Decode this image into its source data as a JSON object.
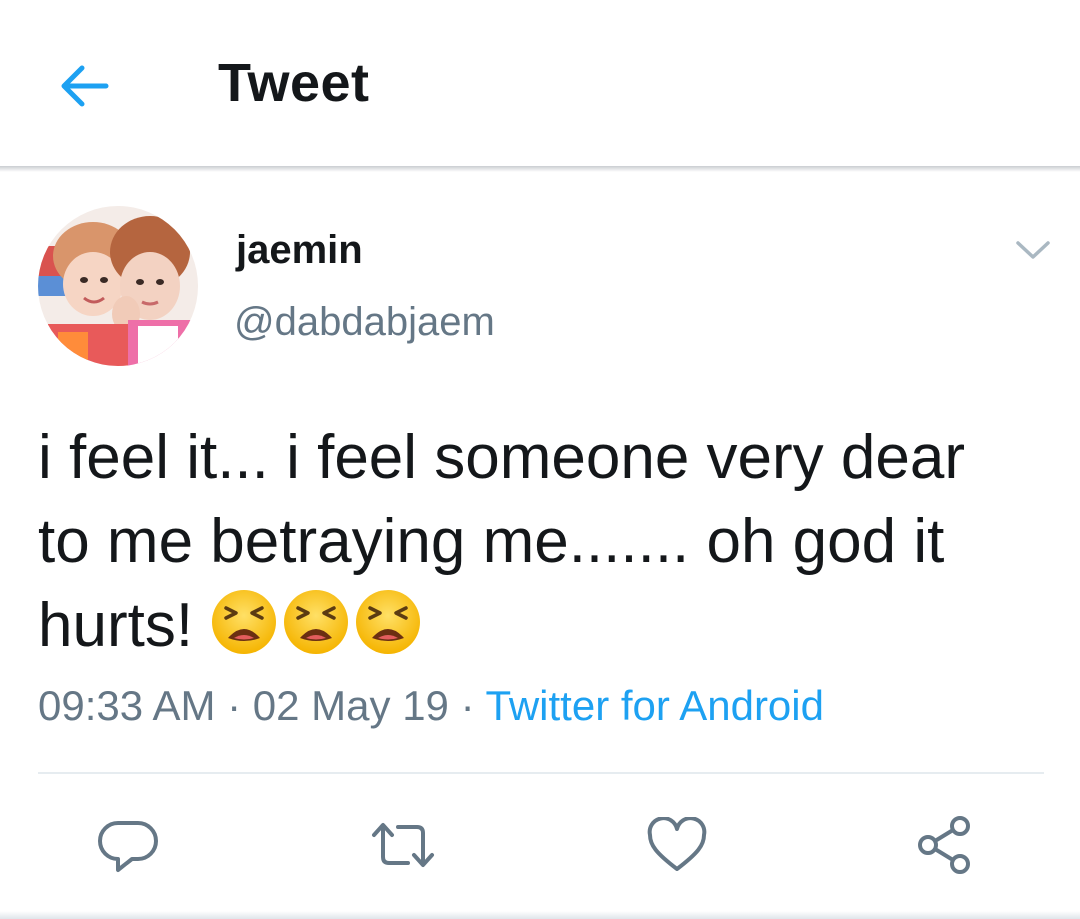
{
  "header": {
    "title": "Tweet",
    "back_icon": "arrow-left-icon",
    "accent_color": "#1da1f2"
  },
  "tweet": {
    "author": {
      "display_name": "jaemin",
      "handle": "@dabdabjaem"
    },
    "text_lines": [
      "i feel it... i feel someone very dear",
      "to me betraying me....... oh god it",
      "hurts!"
    ],
    "emoji": [
      "tired-face-emoji",
      "tired-face-emoji",
      "tired-face-emoji"
    ],
    "time": "09:33 AM",
    "separator": " · ",
    "date": "02 May 19",
    "source": "Twitter for Android"
  },
  "actions": [
    "reply-icon",
    "retweet-icon",
    "like-icon",
    "share-icon"
  ],
  "colors": {
    "text": "#14171a",
    "secondary": "#657786",
    "link": "#1da1f2",
    "divider": "#e6ecf0"
  }
}
